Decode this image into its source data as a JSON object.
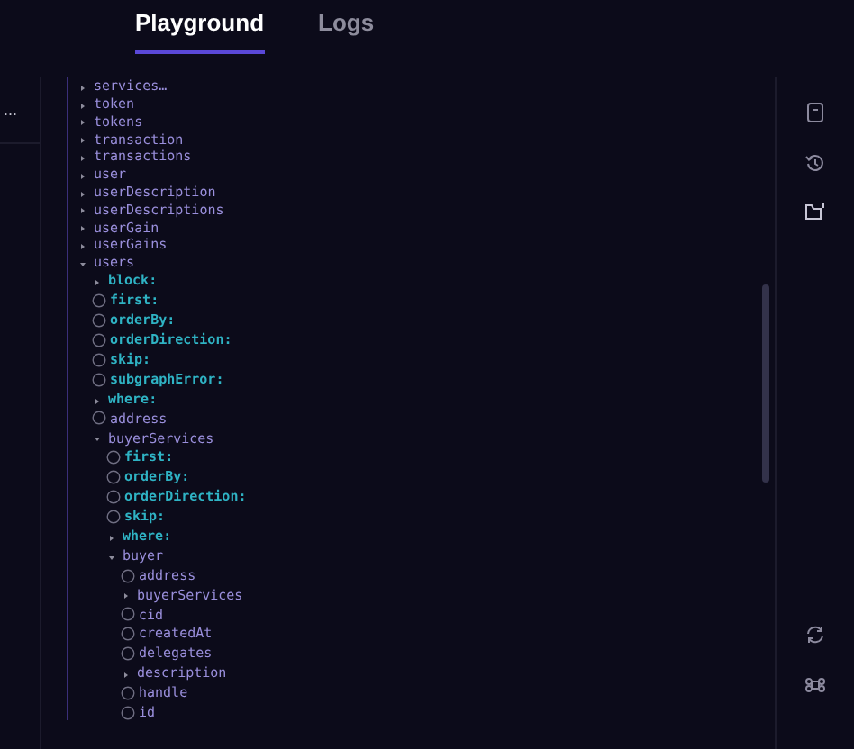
{
  "tabs": [
    {
      "label": "Playground",
      "selected": true
    },
    {
      "label": "Logs",
      "selected": false
    }
  ],
  "sidebar": {
    "menu_label": "..."
  },
  "explorer": {
    "nodes": [
      {
        "label": "services…",
        "kind": "field",
        "expanded": false
      },
      {
        "label": "token",
        "kind": "field",
        "expanded": false
      },
      {
        "label": "tokens",
        "kind": "field",
        "expanded": false
      },
      {
        "label": "transaction",
        "kind": "field",
        "expanded": false
      },
      {
        "label": "transactions",
        "kind": "field",
        "expanded": false
      },
      {
        "label": "user",
        "kind": "field",
        "expanded": false
      },
      {
        "label": "userDescription",
        "kind": "field",
        "expanded": false
      },
      {
        "label": "userDescriptions",
        "kind": "field",
        "expanded": false
      },
      {
        "label": "userGain",
        "kind": "field",
        "expanded": false
      },
      {
        "label": "userGains",
        "kind": "field",
        "expanded": false
      },
      {
        "label": "users",
        "kind": "field",
        "expanded": true,
        "children": [
          {
            "label": "block:",
            "kind": "argument",
            "expanded": false
          },
          {
            "label": "first:",
            "kind": "argument",
            "checked": false
          },
          {
            "label": "orderBy:",
            "kind": "argument",
            "checked": false
          },
          {
            "label": "orderDirection:",
            "kind": "argument",
            "checked": false
          },
          {
            "label": "skip:",
            "kind": "argument",
            "checked": false
          },
          {
            "label": "subgraphError:",
            "kind": "argument",
            "checked": false
          },
          {
            "label": "where:",
            "kind": "argument",
            "expanded": false
          },
          {
            "label": "address",
            "kind": "field",
            "checked": false
          },
          {
            "label": "buyerServices",
            "kind": "field",
            "expanded": true,
            "children": [
              {
                "label": "first:",
                "kind": "argument",
                "checked": false
              },
              {
                "label": "orderBy:",
                "kind": "argument",
                "checked": false
              },
              {
                "label": "orderDirection:",
                "kind": "argument",
                "checked": false
              },
              {
                "label": "skip:",
                "kind": "argument",
                "checked": false
              },
              {
                "label": "where:",
                "kind": "argument",
                "expanded": false
              },
              {
                "label": "buyer",
                "kind": "field",
                "expanded": true,
                "children": [
                  {
                    "label": "address",
                    "kind": "field",
                    "checked": false
                  },
                  {
                    "label": "buyerServices",
                    "kind": "field",
                    "expanded": false
                  },
                  {
                    "label": "cid",
                    "kind": "field",
                    "checked": false
                  },
                  {
                    "label": "createdAt",
                    "kind": "field",
                    "checked": false
                  },
                  {
                    "label": "delegates",
                    "kind": "field",
                    "checked": false
                  },
                  {
                    "label": "description",
                    "kind": "field",
                    "expanded": false
                  },
                  {
                    "label": "handle",
                    "kind": "field",
                    "checked": false
                  },
                  {
                    "label": "id",
                    "kind": "field",
                    "checked": false
                  }
                ]
              }
            ]
          }
        ]
      }
    ]
  }
}
